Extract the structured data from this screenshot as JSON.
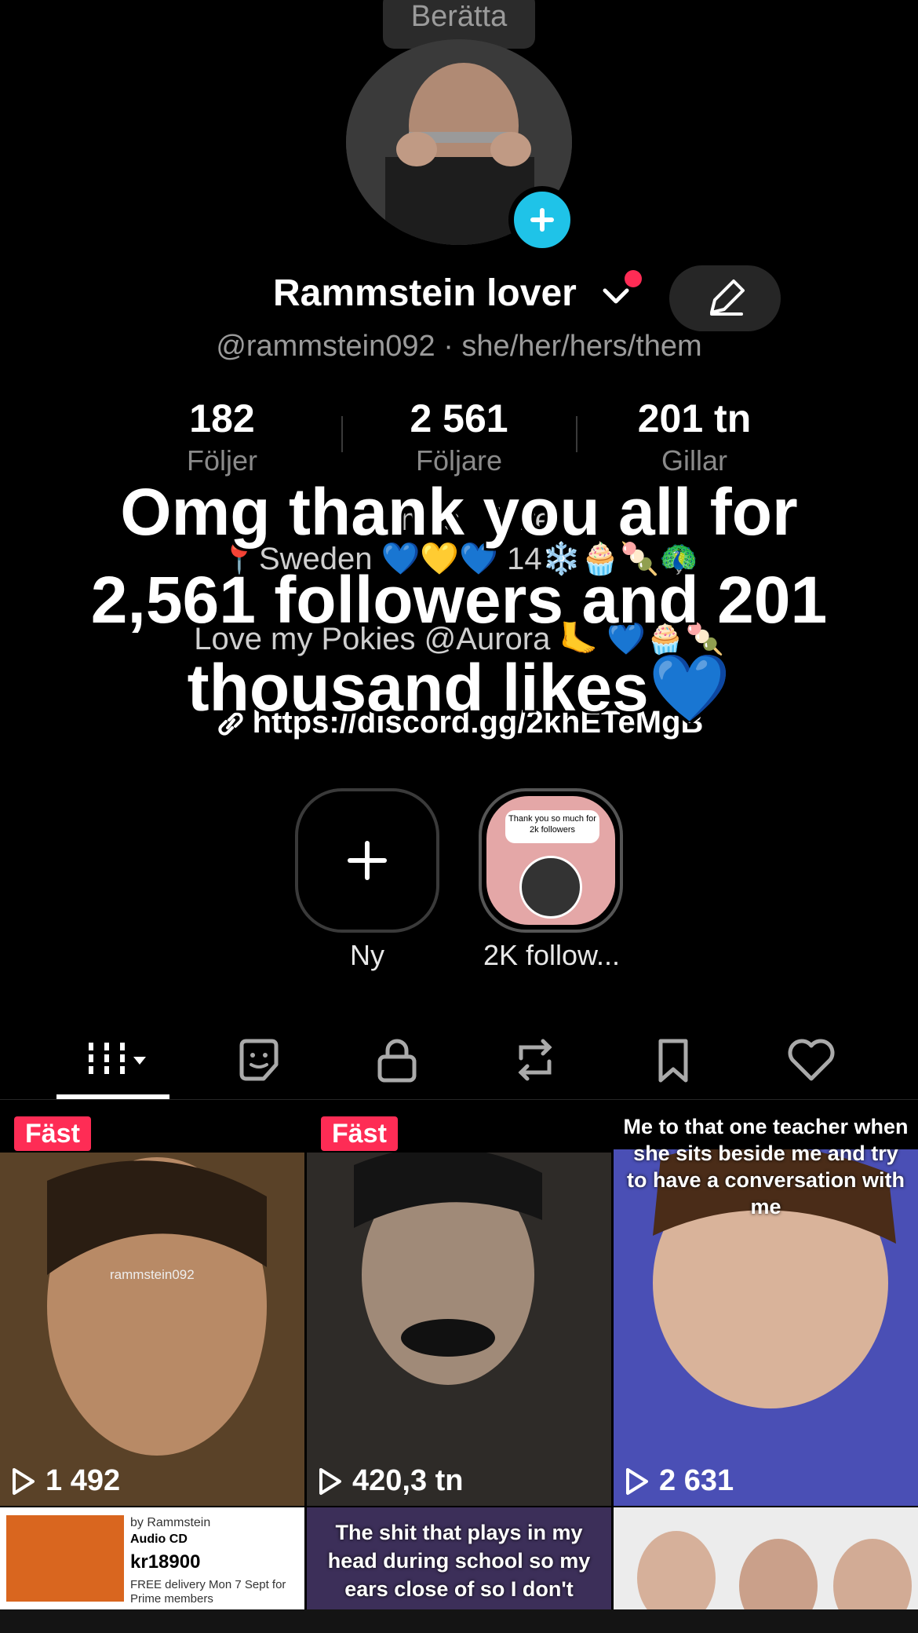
{
  "profile": {
    "tooltip": "Berätta",
    "display_name": "Rammstein lover",
    "handle_line": "@rammstein092 · she/her/hers/them"
  },
  "stats": [
    {
      "value": "182",
      "label": "Följer"
    },
    {
      "value": "2 561",
      "label": "Följare"
    },
    {
      "value": "201 tn",
      "label": "Gillar"
    }
  ],
  "bio": {
    "line1": "    m  s    i  ife",
    "line2": "📍Sweden 💙💛💙 14❄️🧁🍡🦚",
    "line3": "                        ",
    "line4": "Love my Pokies @Aurora 🦶 💙🧁🍡",
    "line5": "",
    "link": "https://discord.gg/2khETeMgB"
  },
  "overlay": {
    "text": "Omg thank you all for 2,561 followers and 201 thousand likes💙"
  },
  "highlights": [
    {
      "label": "Ny"
    },
    {
      "label": "2K follow...",
      "bubble": "Thank you so much for 2k followers"
    }
  ],
  "tabs": [
    "videos-grid",
    "reposts-sticker",
    "private",
    "repost",
    "saved",
    "liked"
  ],
  "grid": [
    {
      "badge": "Fäst",
      "views": "1 492",
      "watermark": "rammstein092"
    },
    {
      "badge": "Fäst",
      "views": "420,3 tn"
    },
    {
      "caption": "Me to that one teacher when she sits beside me and try to have a conversation with me",
      "views": "2 631"
    }
  ],
  "grid_row2": [
    {
      "ad_line1": "by Rammstein",
      "ad_line2": "Audio CD",
      "ad_price": "kr18900",
      "ad_delivery": "FREE delivery Mon 7 Sept for Prime members"
    },
    {
      "caption": "The shit that plays in my head during school so my ears close of so I don't"
    },
    {
      "caption": ""
    }
  ],
  "colors": {
    "accent": "#fe2c55",
    "plus_badge": "#1fc3e8",
    "background": "#000000"
  }
}
